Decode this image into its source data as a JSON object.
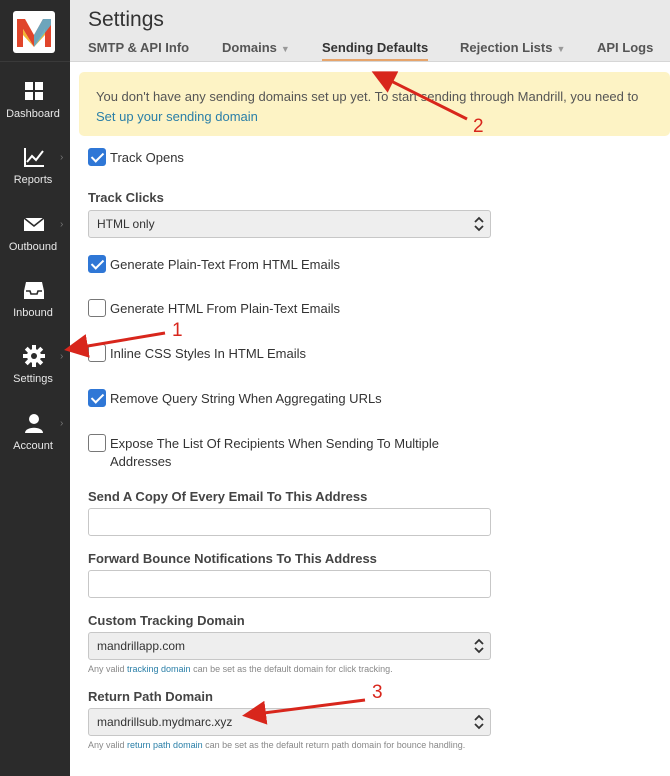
{
  "sidebar": {
    "items": [
      {
        "label": "Dashboard",
        "icon": "dashboard-icon"
      },
      {
        "label": "Reports",
        "icon": "reports-chart-icon"
      },
      {
        "label": "Outbound",
        "icon": "envelope-icon"
      },
      {
        "label": "Inbound",
        "icon": "inbox-icon"
      },
      {
        "label": "Settings",
        "icon": "gear-icon"
      },
      {
        "label": "Account",
        "icon": "user-icon"
      }
    ]
  },
  "header": {
    "title": "Settings",
    "tabs": [
      {
        "label": "SMTP & API Info"
      },
      {
        "label": "Domains"
      },
      {
        "label": "Sending Defaults"
      },
      {
        "label": "Rejection Lists"
      },
      {
        "label": "API Logs"
      }
    ]
  },
  "banner": {
    "text": "You don't have any sending domains set up yet. To start sending through Mandrill, you need to",
    "link": "Set up your sending domain"
  },
  "form": {
    "track_opens": {
      "label": "Track Opens",
      "checked": true
    },
    "track_clicks": {
      "label": "Track Clicks",
      "value": "HTML only"
    },
    "gen_plain": {
      "label": "Generate Plain-Text From HTML Emails",
      "checked": true
    },
    "gen_html": {
      "label": "Generate HTML From Plain-Text Emails",
      "checked": false
    },
    "inline_css": {
      "label": "Inline CSS Styles In HTML Emails",
      "checked": false
    },
    "remove_query": {
      "label": "Remove Query String When Aggregating URLs",
      "checked": true
    },
    "expose_list": {
      "label_line1": "Expose The List Of Recipients When Sending To Multiple",
      "label_line2": "Addresses",
      "checked": false
    },
    "copy_email": {
      "label": "Send A Copy Of Every Email To This Address",
      "value": ""
    },
    "forward_bounce": {
      "label": "Forward Bounce Notifications To This Address",
      "value": ""
    },
    "tracking_domain": {
      "label": "Custom Tracking Domain",
      "value": "mandrillapp.com",
      "help_pre": "Any valid ",
      "help_link": "tracking domain",
      "help_post": " can be set as the default domain for click tracking."
    },
    "return_path": {
      "label": "Return Path Domain",
      "value": "mandrillsub.mydmarc.xyz",
      "help_pre": "Any valid ",
      "help_link": "return path domain",
      "help_post": " can be set as the default return path domain for bounce handling."
    }
  },
  "annotations": {
    "one": "1",
    "two": "2",
    "three": "3",
    "color": "#d8261c"
  },
  "colors": {
    "sidebar_bg": "#2b2b2b",
    "header_bg": "#e9e9e9",
    "banner_bg": "#fdf3c5",
    "checkbox_checked": "#2f77d6",
    "link": "#2a7fa8",
    "active_tab_underline": "#e6a46b"
  }
}
